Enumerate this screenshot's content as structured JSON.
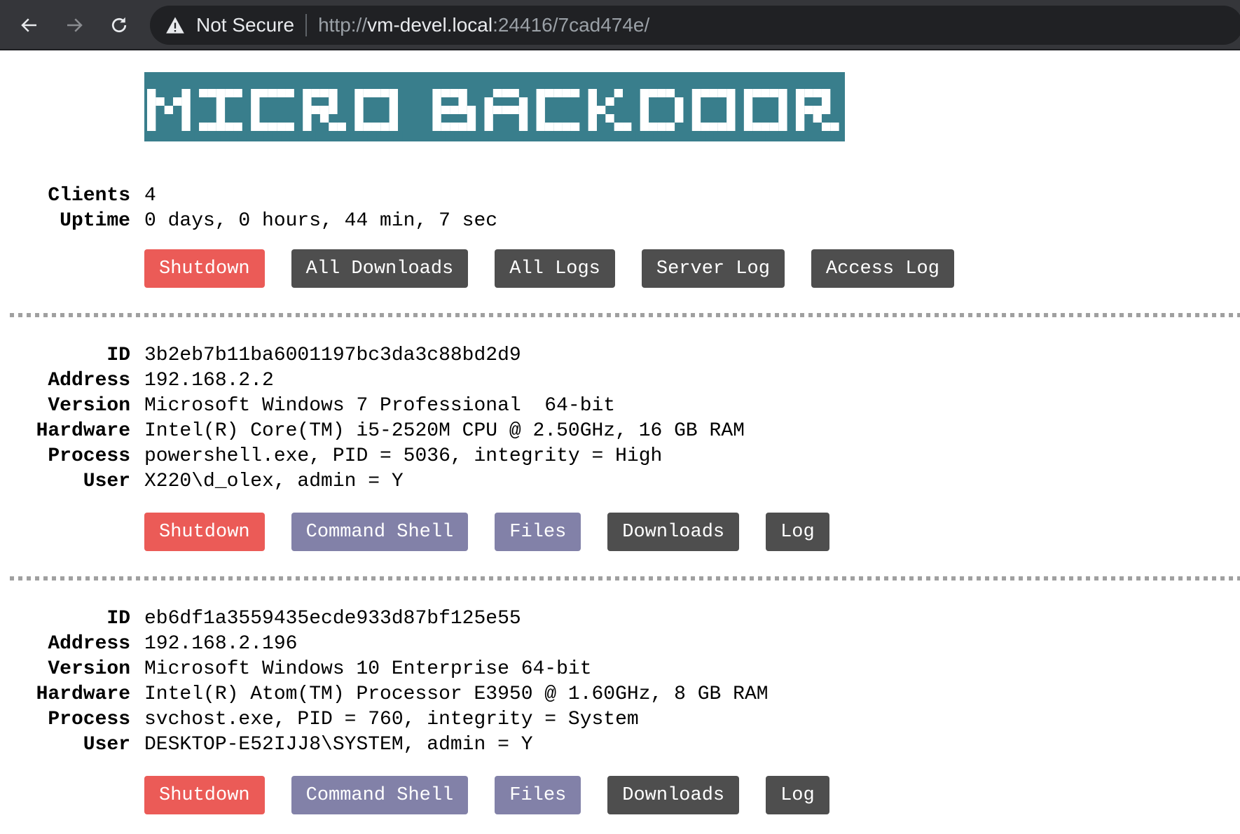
{
  "browser": {
    "security_label": "Not Secure",
    "url_scheme": "http://",
    "url_host": "vm-devel.local",
    "url_rest": ":24416/7cad474e/",
    "icons": {
      "back": "arrow-left-icon",
      "forward": "arrow-right-icon",
      "reload": "reload-icon",
      "warning": "warning-triangle-icon"
    }
  },
  "logo": {
    "text": "MICRO BACKDOOR",
    "bg_color": "#397e8c",
    "fg_color": "#ffffff"
  },
  "server": {
    "clients_label": "Clients",
    "clients_value": "4",
    "uptime_label": "Uptime",
    "uptime_value": "0 days, 0 hours, 44 min, 7 sec",
    "buttons": [
      {
        "label": "Shutdown",
        "color": "#eb5b57"
      },
      {
        "label": "All Downloads",
        "color": "#4e4e4e"
      },
      {
        "label": "All Logs",
        "color": "#4e4e4e"
      },
      {
        "label": "Server Log",
        "color": "#4e4e4e"
      },
      {
        "label": "Access Log",
        "color": "#4e4e4e"
      }
    ]
  },
  "client_fields": [
    "ID",
    "Address",
    "Version",
    "Hardware",
    "Process",
    "User"
  ],
  "clients": [
    {
      "id": "3b2eb7b11ba6001197bc3da3c88bd2d9",
      "address": "192.168.2.2",
      "version": "Microsoft Windows 7 Professional  64-bit",
      "hardware": "Intel(R) Core(TM) i5-2520M CPU @ 2.50GHz, 16 GB RAM",
      "process": "powershell.exe, PID = 5036, integrity = High",
      "user": "X220\\d_olex, admin = Y",
      "buttons": [
        "Shutdown",
        "Command Shell",
        "Files",
        "Downloads",
        "Log"
      ]
    },
    {
      "id": "eb6df1a3559435ecde933d87bf125e55",
      "address": "192.168.2.196",
      "version": "Microsoft Windows 10 Enterprise 64-bit",
      "hardware": "Intel(R) Atom(TM) Processor E3950 @ 1.60GHz, 8 GB RAM",
      "process": "svchost.exe, PID = 760, integrity = System",
      "user": "DESKTOP-E52IJJ8\\SYSTEM, admin = Y",
      "buttons": [
        "Shutdown",
        "Command Shell",
        "Files",
        "Downloads",
        "Log"
      ]
    }
  ],
  "colors": {
    "shutdown": "#eb5b57",
    "action": "#8281a8",
    "neutral": "#4e4e4e",
    "separator": "#a0a0a0"
  }
}
